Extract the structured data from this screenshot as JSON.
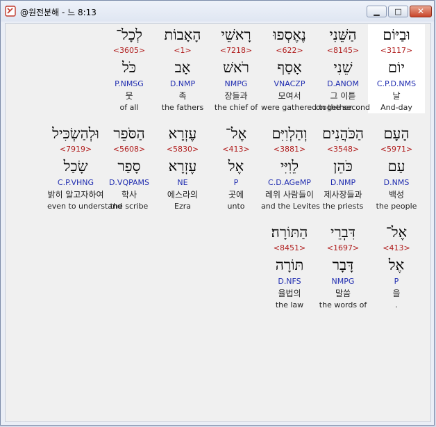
{
  "window": {
    "title": "@원전분해 - 느 8:13",
    "min_glyph": "▁",
    "max_glyph": "□",
    "close_glyph": "✕",
    "accent_close": "#c8452a"
  },
  "rows": [
    {
      "words": [
        {
          "hebrew": "וּבַיּוֹם",
          "strong": "<3117>",
          "lemma": "יוֹם",
          "morph": "C.P.D.NMS",
          "korean": "날",
          "english": "And-day",
          "highlighted": true
        },
        {
          "hebrew": "הַשֵּׁנִי",
          "strong": "<8145>",
          "lemma": "שֵׁנִי",
          "morph": "D.ANOM",
          "korean": "그 이튿",
          "english": "on the second",
          "highlighted": false
        },
        {
          "hebrew": "נֶאֶסְפוּ",
          "strong": "<622>",
          "lemma": "אָסַף",
          "morph": "VNACZP",
          "korean": "모여서",
          "english": "were gathered together",
          "highlighted": false
        },
        {
          "hebrew": "רָאשֵׁי",
          "strong": "<7218>",
          "lemma": "רֹאשׁ",
          "morph": "NMPG",
          "korean": "장들과",
          "english": "the chief of",
          "highlighted": false
        },
        {
          "hebrew": "הָאָבוֹת",
          "strong": "<1>",
          "lemma": "אָב",
          "morph": "D.NMP",
          "korean": "족",
          "english": "the fathers",
          "highlighted": false
        },
        {
          "hebrew": "לְכָל־",
          "strong": "<3605>",
          "lemma": "כֹּל",
          "morph": "P.NMSG",
          "korean": "뭇",
          "english": "of all",
          "highlighted": false
        }
      ]
    },
    {
      "words": [
        {
          "hebrew": "הָעָם",
          "strong": "<5971>",
          "lemma": "עַם",
          "morph": "D.NMS",
          "korean": "백성",
          "english": "the people",
          "highlighted": false
        },
        {
          "hebrew": "הַכֹּהֲנִים",
          "strong": "<3548>",
          "lemma": "כֹּהֵן",
          "morph": "D.NMP",
          "korean": "제사장들과",
          "english": "the priests",
          "highlighted": false
        },
        {
          "hebrew": "וְהַלְוִיִּם",
          "strong": "<3881>",
          "lemma": "לֵוִיִּי",
          "morph": "C.D.AGeMP",
          "korean": "레위 사람들이",
          "english": "and the Levites",
          "highlighted": false
        },
        {
          "hebrew": "אֶל־",
          "strong": "<413>",
          "lemma": "אֶל",
          "morph": "P",
          "korean": "곳에",
          "english": "unto",
          "highlighted": false
        },
        {
          "hebrew": "עֶזְרָא",
          "strong": "<5830>",
          "lemma": "עֶזְרָא",
          "morph": "NE",
          "korean": "에스라의",
          "english": "Ezra",
          "highlighted": false
        },
        {
          "hebrew": "הַסֹּפֵר",
          "strong": "<5608>",
          "lemma": "סָפַר",
          "morph": "D.VQPAMS",
          "korean": "학사",
          "english": "the scribe",
          "highlighted": false
        },
        {
          "hebrew": "וּלְהַשְׂכִּיל",
          "strong": "<7919>",
          "lemma": "שָׂכַל",
          "morph": "C.P.VHNG",
          "korean": "밝히 알고자하여",
          "english": "even to understand",
          "highlighted": false
        }
      ]
    },
    {
      "words": [
        {
          "hebrew": "אֶל־",
          "strong": "<413>",
          "lemma": "אֶל",
          "morph": "P",
          "korean": "을",
          "english": ".",
          "highlighted": false
        },
        {
          "hebrew": "דִּבְרֵי",
          "strong": "<1697>",
          "lemma": "דָּבָר",
          "morph": "NMPG",
          "korean": "말씀",
          "english": "the words of",
          "highlighted": false
        },
        {
          "hebrew": "הַתּוֹרָה׃",
          "strong": "<8451>",
          "lemma": "תּוֹרָה",
          "morph": "D.NFS",
          "korean": "율법의",
          "english": "the law",
          "highlighted": false
        }
      ]
    }
  ]
}
